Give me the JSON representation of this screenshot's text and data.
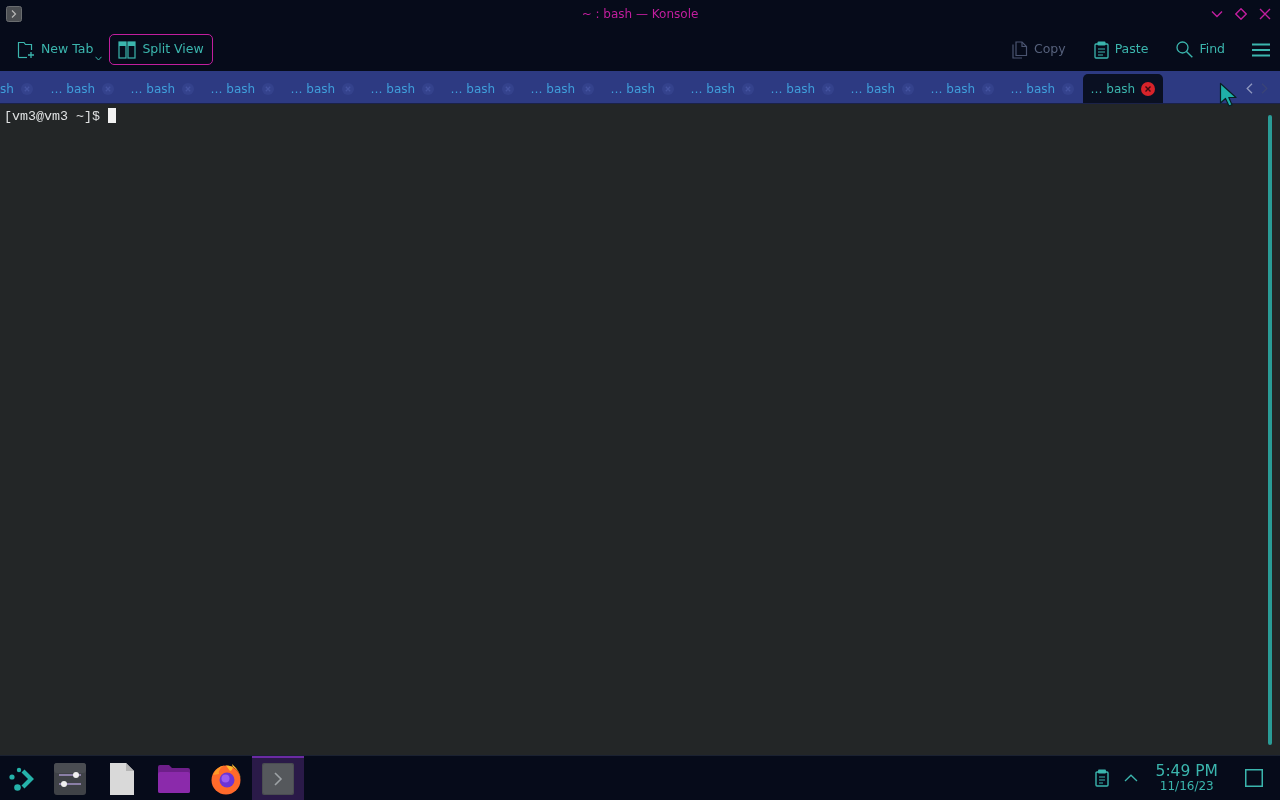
{
  "window": {
    "title": "~ : bash — Konsole"
  },
  "toolbar": {
    "left_actions": [
      {
        "label": "New Tab",
        "kind": "new-tab",
        "checked": false
      },
      {
        "label": "Split View",
        "kind": "split-view",
        "checked": true
      }
    ],
    "right_actions": [
      {
        "label": "Copy",
        "kind": "copy",
        "disabled": true
      },
      {
        "label": "Paste",
        "kind": "paste",
        "disabled": false
      },
      {
        "label": "Find",
        "kind": "find",
        "disabled": false
      }
    ]
  },
  "tabs": [
    {
      "label": "sh",
      "selected": false
    },
    {
      "label": "… bash",
      "selected": false
    },
    {
      "label": "… bash",
      "selected": false
    },
    {
      "label": "… bash",
      "selected": false
    },
    {
      "label": "… bash",
      "selected": false
    },
    {
      "label": "… bash",
      "selected": false
    },
    {
      "label": "… bash",
      "selected": false
    },
    {
      "label": "… bash",
      "selected": false
    },
    {
      "label": "… bash",
      "selected": false
    },
    {
      "label": "… bash",
      "selected": false
    },
    {
      "label": "… bash",
      "selected": false
    },
    {
      "label": "… bash",
      "selected": false
    },
    {
      "label": "… bash",
      "selected": false
    },
    {
      "label": "… bash",
      "selected": false
    },
    {
      "label": "… bash",
      "selected": true
    }
  ],
  "tab_scroll": [
    {
      "kind": "left",
      "disabled": false
    },
    {
      "kind": "right",
      "disabled": true
    }
  ],
  "terminal": {
    "prompt": "[vm3@vm3 ~]$"
  },
  "taskbar": {
    "apps": [
      {
        "kind": "launcher",
        "selected": false
      },
      {
        "kind": "settings",
        "selected": false
      },
      {
        "kind": "document",
        "selected": false
      },
      {
        "kind": "folder",
        "selected": false
      },
      {
        "kind": "browser",
        "selected": false
      },
      {
        "kind": "terminal",
        "selected": true
      }
    ],
    "clock": {
      "time": "5:49 PM",
      "date": "11/16/23"
    }
  }
}
